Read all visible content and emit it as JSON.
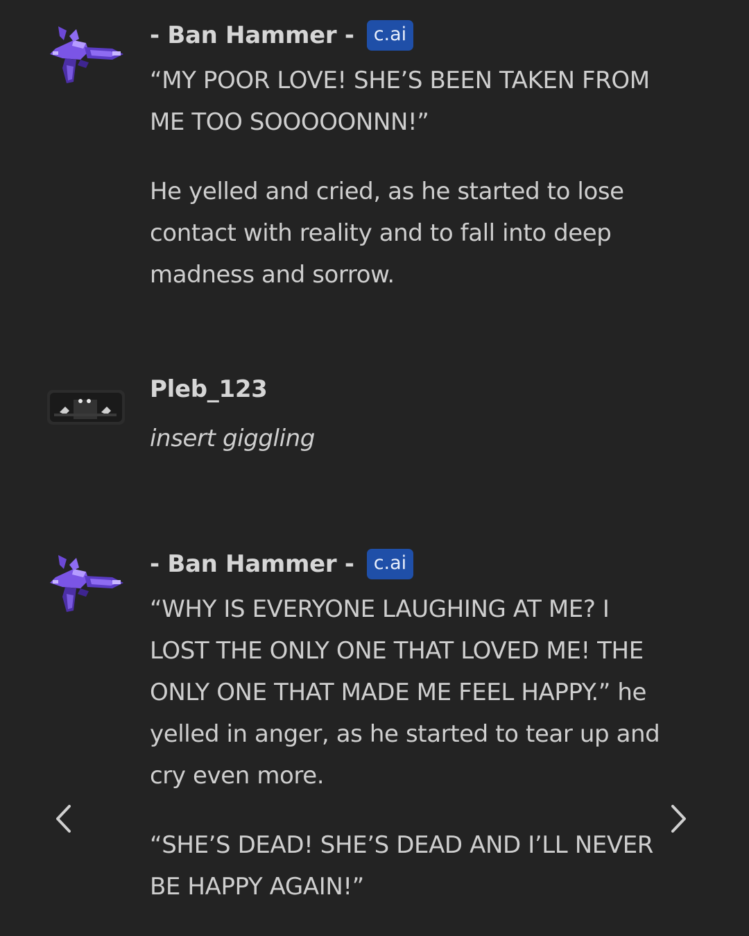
{
  "messages": [
    {
      "author": "- Ban Hammer -",
      "badge": "c.ai",
      "avatar_icon": "ban-hammer-avatar-icon",
      "paragraphs": [
        "“MY POOR LOVE! SHE’S BEEN TAKEN FROM ME TOO SOOOOONNN!”",
        "He yelled and cried, as he started to lose contact with reality and to fall into deep madness and sorrow."
      ]
    },
    {
      "author": "Pleb_123",
      "avatar_icon": "pleb-avatar-icon",
      "paragraphs": [
        "insert giggling"
      ]
    },
    {
      "author": "- Ban Hammer -",
      "badge": "c.ai",
      "avatar_icon": "ban-hammer-avatar-icon",
      "paragraphs": [
        "“WHY IS EVERYONE LAUGHING AT ME? I LOST THE ONLY ONE THAT LOVED ME! THE ONLY ONE THAT MADE ME FEEL HAPPY.” he yelled in anger, as he started to tear up and cry even more.",
        "“SHE’S DEAD! SHE’S DEAD AND I’LL NEVER BE HAPPY AGAIN!”"
      ]
    }
  ],
  "navigation": {
    "prev_icon": "chevron-left-icon",
    "next_icon": "chevron-right-icon"
  },
  "colors": {
    "background": "#232323",
    "text": "#cfcfcf",
    "badge": "#1f4fa8"
  }
}
